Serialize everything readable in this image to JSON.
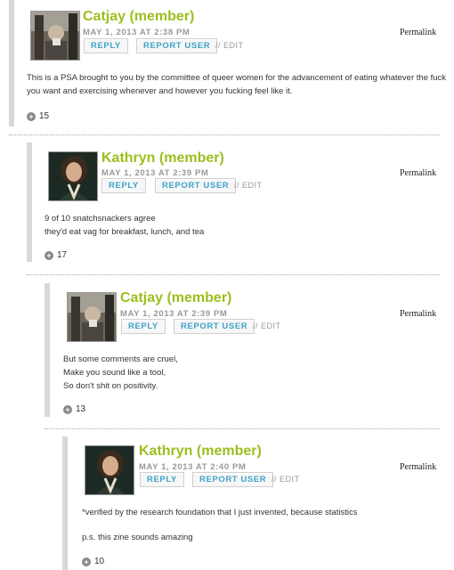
{
  "common": {
    "reply_label": "REPLY",
    "report_label": "REPORT USER",
    "edit_label": "// EDIT",
    "permalink_label": "Permalink"
  },
  "comments": [
    {
      "author": "Catjay (member)",
      "date": "MAY 1, 2013 AT 2:38 PM",
      "body": [
        "This is a PSA brought to you by the committee of queer women for the advancement of eating whatever the fuck you want and exercising whenever and however you fucking feel like it."
      ],
      "likes": "15"
    },
    {
      "author": "Kathryn (member)",
      "date": "MAY 1, 2013 AT 2:39 PM",
      "body": [
        "9 of 10 snatchsnackers agree",
        "they'd eat vag for breakfast, lunch, and tea"
      ],
      "likes": "17"
    },
    {
      "author": "Catjay (member)",
      "date": "MAY 1, 2013 AT 2:39 PM",
      "body": [
        "But some comments are cruel,",
        "Make you sound like a tool,",
        "So don't shit on positivity."
      ],
      "likes": "13"
    },
    {
      "author": "Kathryn (member)",
      "date": "MAY 1, 2013 AT 2:40 PM",
      "body": [
        "*verified by the research foundation that I just invented, because statistics",
        "",
        "p.s. this zine sounds amazing"
      ],
      "likes": "10"
    }
  ]
}
